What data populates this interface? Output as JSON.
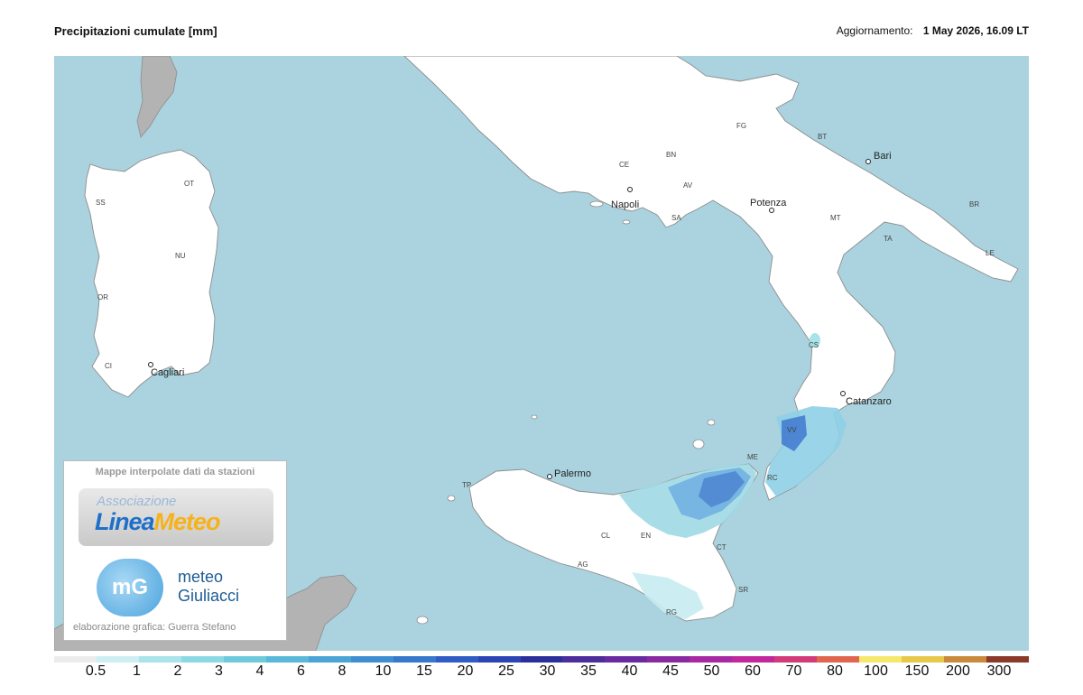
{
  "header": {
    "title": "Precipitazioni cumulate [mm]",
    "update_label": "Aggiornamento:",
    "update_value": "1 May 2026, 16.09 LT"
  },
  "map": {
    "cities": [
      "Napoli",
      "Bari",
      "Potenza",
      "Catanzaro",
      "Palermo",
      "Cagliari"
    ],
    "provinces": [
      "SS",
      "OT",
      "NU",
      "OR",
      "CI",
      "FG",
      "BT",
      "CE",
      "BN",
      "AV",
      "SA",
      "MT",
      "TA",
      "BR",
      "LE",
      "CS",
      "VV",
      "RC",
      "ME",
      "TP",
      "CL",
      "EN",
      "AG",
      "CT",
      "SR",
      "RG"
    ],
    "colors": {
      "sea": "#aad3df",
      "land": "#ffffff",
      "foreign_land": "#b3b3b3",
      "border": "#8c8c8c"
    }
  },
  "logo": {
    "heading": "Mappe interpolate dati da stazioni",
    "assoc": "Associazione",
    "brand_a": "Linea",
    "brand_b": "Meteo",
    "mg_initials": "mG",
    "mg_line1": "meteo",
    "mg_line2": "Giuliacci",
    "credit": "elaborazione grafica: Guerra Stefano"
  },
  "legend": {
    "labels": [
      "0.5",
      "1",
      "2",
      "3",
      "4",
      "6",
      "8",
      "10",
      "15",
      "20",
      "25",
      "30",
      "35",
      "40",
      "45",
      "50",
      "60",
      "70",
      "80",
      "100",
      "150",
      "200",
      "300"
    ],
    "colors": [
      "#ececec",
      "#cfeef3",
      "#a8e4ea",
      "#8dd9e3",
      "#6fcbdc",
      "#5ab9d8",
      "#4aa5d6",
      "#3d8fd2",
      "#3777cc",
      "#2f5dc3",
      "#2c45b5",
      "#2b2f9c",
      "#4b2d9c",
      "#6a2aa0",
      "#8a2aa3",
      "#a82aa2",
      "#c0289b",
      "#d23c7a",
      "#e0664f",
      "#f4e96a",
      "#e8c84a",
      "#c98a3c",
      "#8b3a2a"
    ]
  }
}
